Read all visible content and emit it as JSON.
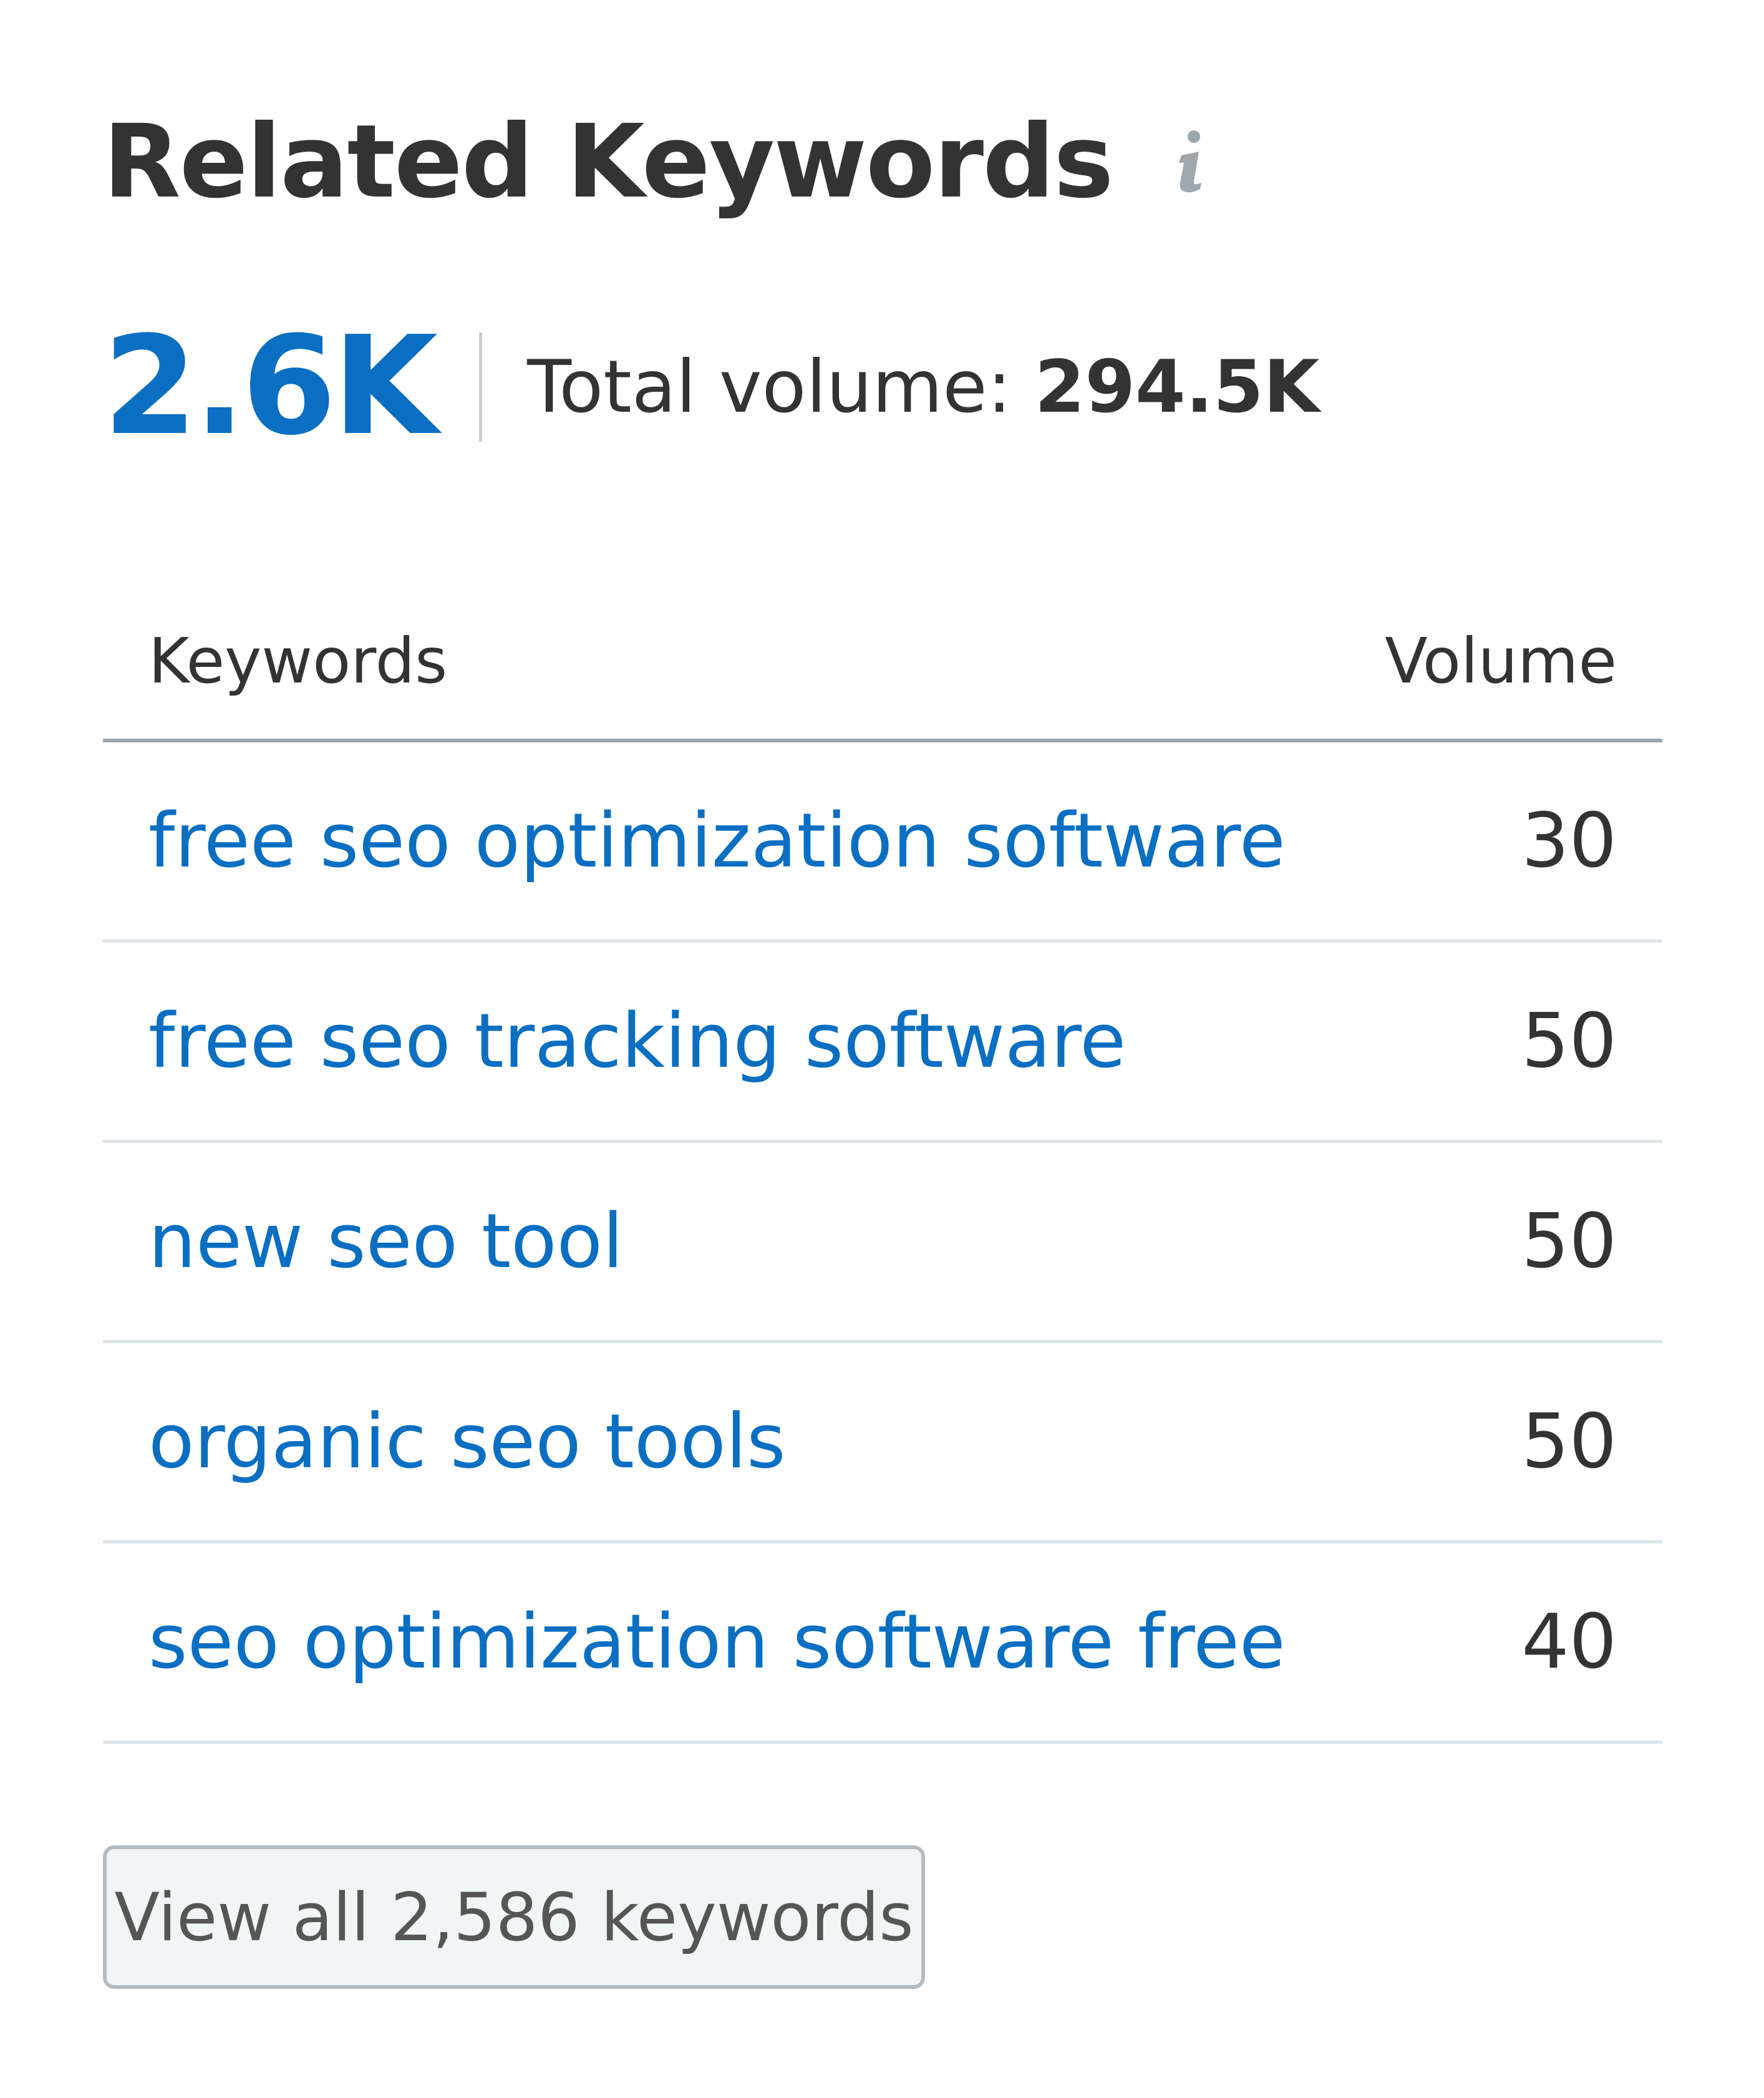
{
  "header": {
    "title": "Related Keywords",
    "info_icon": "info-icon"
  },
  "summary": {
    "count": "2.6K",
    "total_label": "Total volume: ",
    "total_value": "294.5K"
  },
  "table": {
    "columns": [
      "Keywords",
      "Volume"
    ],
    "rows": [
      {
        "keyword": "free seo optimization software",
        "volume": "30"
      },
      {
        "keyword": "free seo tracking software",
        "volume": "50"
      },
      {
        "keyword": "new seo tool",
        "volume": "50"
      },
      {
        "keyword": "organic seo tools",
        "volume": "50"
      },
      {
        "keyword": "seo optimization software free",
        "volume": "40"
      }
    ]
  },
  "footer": {
    "view_all_label": "View all 2,586 keywords"
  },
  "colors": {
    "accent": "#0a6fc2",
    "text": "#333333",
    "muted_icon": "#9ea7ad",
    "row_divider": "#dfe4e7",
    "header_divider": "#9ea5aa",
    "button_bg": "#f2f5f6",
    "button_border": "#b4bcc2"
  }
}
